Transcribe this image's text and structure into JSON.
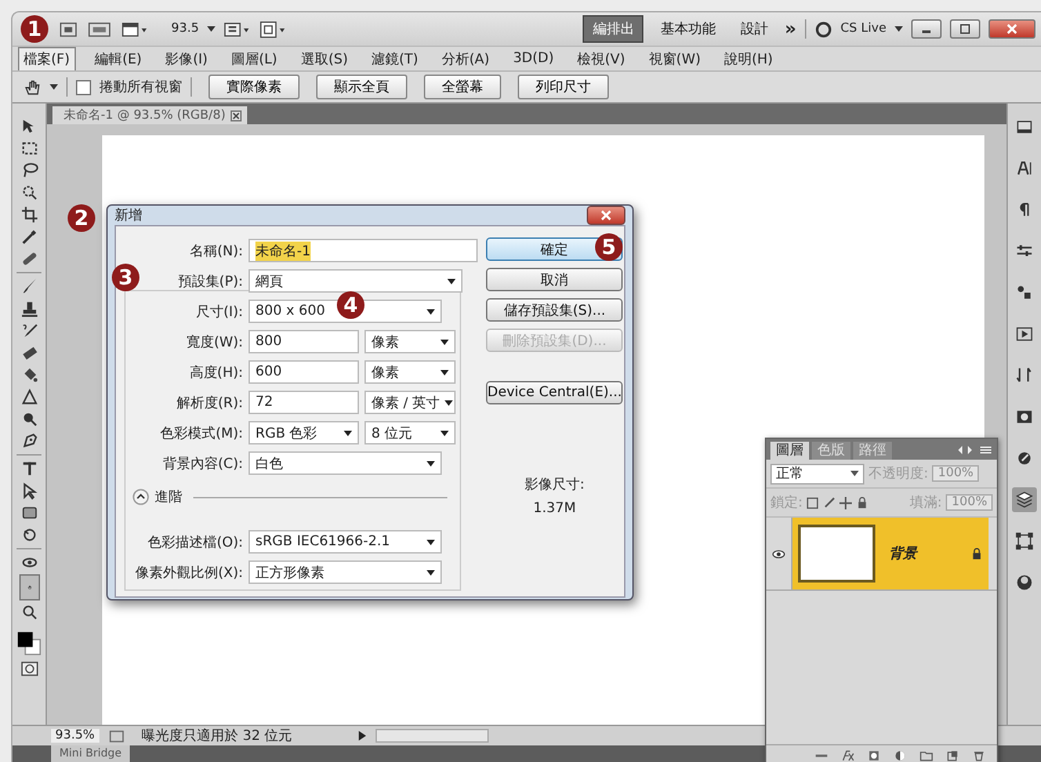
{
  "app_bar": {
    "zoom": "93.5",
    "workspaces": [
      {
        "label": "編排出",
        "selected": true
      },
      {
        "label": "基本功能",
        "selected": false
      },
      {
        "label": "設計",
        "selected": false
      }
    ],
    "more": "»",
    "cs_live": "CS Live"
  },
  "menu": [
    {
      "label": "檔案(F)",
      "selected": true
    },
    {
      "label": "編輯(E)",
      "selected": false
    },
    {
      "label": "影像(I)",
      "selected": false
    },
    {
      "label": "圖層(L)",
      "selected": false
    },
    {
      "label": "選取(S)",
      "selected": false
    },
    {
      "label": "濾鏡(T)",
      "selected": false
    },
    {
      "label": "分析(A)",
      "selected": false
    },
    {
      "label": "3D(D)",
      "selected": false
    },
    {
      "label": "檢視(V)",
      "selected": false
    },
    {
      "label": "視窗(W)",
      "selected": false
    },
    {
      "label": "說明(H)",
      "selected": false
    }
  ],
  "options_bar": {
    "scroll_all": {
      "label": "捲動所有視窗",
      "checked": false
    },
    "buttons": [
      "實際像素",
      "顯示全頁",
      "全螢幕",
      "列印尺寸"
    ]
  },
  "document_tab": {
    "title": "未命名-1 @ 93.5% (RGB/8)"
  },
  "dialog": {
    "title": "新增",
    "fields": [
      {
        "kind": "name",
        "label": "名稱(N):",
        "controls": [
          {
            "kind": "input",
            "value": "未命名-1",
            "highlighted": true
          }
        ]
      },
      {
        "kind": "preset",
        "label": "預設集(P):",
        "controls": [
          {
            "kind": "select",
            "value": "網頁"
          }
        ]
      },
      {
        "kind": "single",
        "label": "尺寸(I):",
        "controls": [
          {
            "kind": "select",
            "value": "800 x 600"
          }
        ]
      },
      {
        "kind": "pair",
        "label": "寬度(W):",
        "controls": [
          {
            "kind": "input",
            "value": "800"
          },
          {
            "kind": "select",
            "value": "像素"
          }
        ]
      },
      {
        "kind": "pair",
        "label": "高度(H):",
        "controls": [
          {
            "kind": "input",
            "value": "600"
          },
          {
            "kind": "select",
            "value": "像素"
          }
        ]
      },
      {
        "kind": "pair",
        "label": "解析度(R):",
        "controls": [
          {
            "kind": "input",
            "value": "72"
          },
          {
            "kind": "select",
            "value": "像素 / 英寸"
          }
        ]
      },
      {
        "kind": "pair",
        "label": "色彩模式(M):",
        "controls": [
          {
            "kind": "select",
            "value": "RGB 色彩"
          },
          {
            "kind": "select",
            "value": "8 位元"
          }
        ]
      },
      {
        "kind": "single",
        "label": "背景內容(C):",
        "controls": [
          {
            "kind": "select",
            "value": "白色"
          }
        ]
      }
    ],
    "advanced": {
      "label": "進階",
      "expanded": true
    },
    "advanced_fields": [
      {
        "kind": "single",
        "label": "色彩描述檔(O):",
        "controls": [
          {
            "kind": "select",
            "value": "sRGB IEC61966-2.1"
          }
        ]
      },
      {
        "kind": "single",
        "label": "像素外觀比例(X):",
        "controls": [
          {
            "kind": "select",
            "value": "正方形像素"
          }
        ]
      }
    ],
    "buttons": [
      {
        "label": "確定",
        "default": true,
        "disabled": false
      },
      {
        "label": "取消",
        "default": false,
        "disabled": false
      },
      {
        "label": "儲存預設集(S)...",
        "default": false,
        "disabled": false
      },
      {
        "label": "刪除預設集(D)...",
        "default": false,
        "disabled": true
      },
      {
        "label": "Device Central(E)...",
        "default": false,
        "disabled": false
      }
    ],
    "image_size": {
      "label": "影像尺寸:",
      "value": "1.37M"
    }
  },
  "layers_panel": {
    "tabs": [
      {
        "label": "圖層",
        "selected": true
      },
      {
        "label": "色版",
        "selected": false
      },
      {
        "label": "路徑",
        "selected": false
      }
    ],
    "blend_mode": "正常",
    "opacity": {
      "label": "不透明度:",
      "value": "100%",
      "disabled": true
    },
    "lock_label": "鎖定:",
    "fill": {
      "label": "填滿:",
      "value": "100%",
      "disabled": true
    },
    "layers": [
      {
        "name": "背景",
        "visible": true,
        "locked": true,
        "selected": true
      }
    ]
  },
  "status_bar": {
    "zoom": "93.5%",
    "info": "曝光度只適用於 32 位元"
  },
  "mini_bridge": "Mini Bridge",
  "callouts": [
    "1",
    "2",
    "3",
    "4",
    "5"
  ]
}
